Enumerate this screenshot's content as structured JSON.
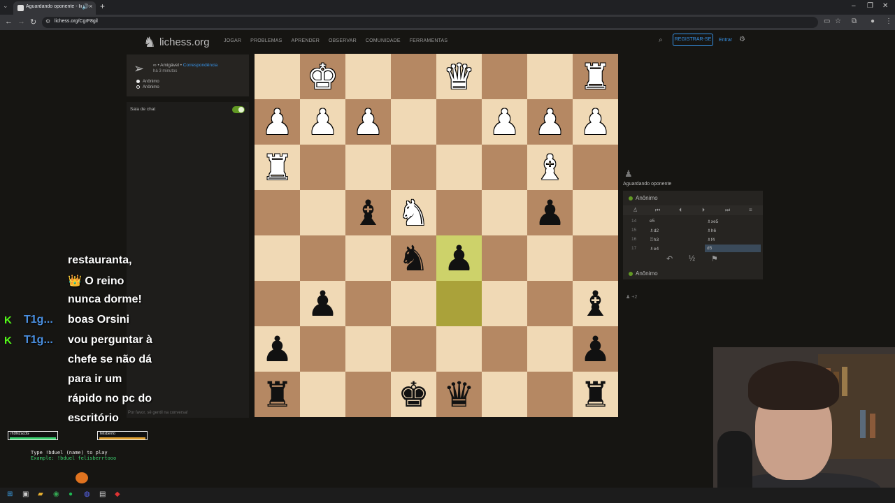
{
  "browser": {
    "tab_title": "Aguardando oponente - lic",
    "url": "lichess.org/CgrF8gil"
  },
  "site": {
    "logo_text": "lichess.org",
    "nav": [
      "JOGAR",
      "PROBLEMAS",
      "APRENDER",
      "OBSERVAR",
      "COMUNIDADE",
      "FERRAMENTAS"
    ],
    "signup_label": "REGISTRAR-SE",
    "signin_label": "Entrar"
  },
  "game_info": {
    "mode_prefix": "∞ • Amigável • ",
    "mode_link": "Correspondência",
    "time_ago": "há 3 minutos",
    "players": [
      "Anônimo",
      "Anônimo"
    ]
  },
  "chat": {
    "header": "Sala de chat",
    "placeholder": "Por favor, sê gentil na conversa!"
  },
  "overlay_chat": {
    "lines": [
      "restauranta,",
      "👑 O reino",
      "nunca dorme!",
      "boas Orsini",
      "vou perguntar à",
      "chefe se não dá",
      "para ir um",
      "rápido no pc do",
      "escritório"
    ],
    "users": [
      "T1g...",
      "T1g..."
    ],
    "duel_left": "rhDNZacdG",
    "duel_right": "felisberrto",
    "duel_instructions": "Type !bduel (name) to play",
    "duel_example": "Example: !bduel felisberrtooo"
  },
  "board": {
    "rows": [
      [
        "",
        "wK",
        "",
        "",
        "wQ",
        "",
        "",
        "wR"
      ],
      [
        "wP",
        "wP",
        "wP",
        "",
        "",
        "wP",
        "wP",
        "wP"
      ],
      [
        "wR",
        "",
        "",
        "",
        "",
        "",
        "wB",
        ""
      ],
      [
        "",
        "",
        "bB",
        "wN",
        "",
        "",
        "bP",
        ""
      ],
      [
        "",
        "",
        "",
        "bN",
        "bP",
        "",
        "",
        ""
      ],
      [
        "",
        "bP",
        "",
        "",
        "",
        "",
        "",
        "bB"
      ],
      [
        "bP",
        "",
        "",
        "",
        "",
        "",
        "",
        "bP"
      ],
      [
        "bR",
        "",
        "",
        "bK",
        "bQ",
        "",
        "",
        "bR"
      ]
    ],
    "highlighted": [
      [
        4,
        4
      ],
      [
        5,
        4
      ]
    ]
  },
  "right_panel": {
    "status": "Aguardando oponente",
    "top_player": "Anônimo",
    "bottom_player": "Anônimo",
    "moves": [
      {
        "num": "14",
        "white": "e5",
        "black": "♗xe5"
      },
      {
        "num": "15",
        "white": "♗d2",
        "black": "♗h6"
      },
      {
        "num": "16",
        "white": "♖h3",
        "black": "♗f4"
      },
      {
        "num": "17",
        "white": "♗e4",
        "black": "d5"
      }
    ],
    "material_diff": "+2"
  },
  "colors": {
    "light_square": "#f0d9b5",
    "dark_square": "#b58863",
    "highlight": "#aaa23a",
    "link": "#3692e7",
    "online": "#629924"
  }
}
